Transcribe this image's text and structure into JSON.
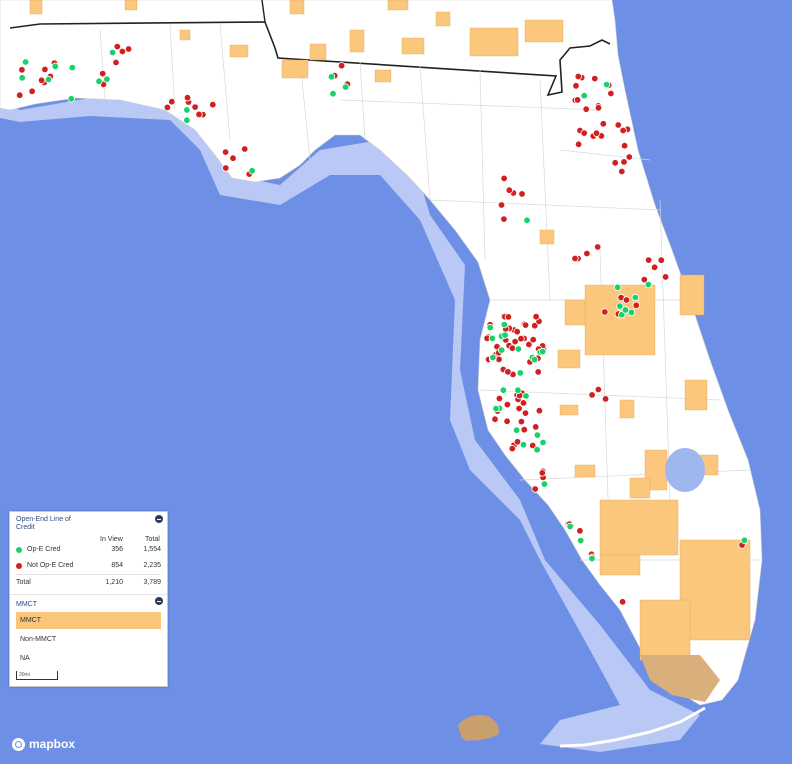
{
  "map": {
    "colors": {
      "water": "#6d8fe6",
      "shelf": "#b9c8f4",
      "land": "#ffffff",
      "mmct": "#fbc77d",
      "na": "#d9b07c",
      "op_e_cred": "#19d16a",
      "not_op_e_cred": "#d0201f"
    }
  },
  "legend": {
    "title": "Open-End Line of Credit",
    "col_in_view": "In View",
    "col_total": "Total",
    "rows": [
      {
        "label": "Op-E Cred",
        "in_view": "356",
        "total": "1,554",
        "color": "#19d16a"
      },
      {
        "label": "Not Op-E Cred",
        "in_view": "854",
        "total": "2,235",
        "color": "#d0201f"
      }
    ],
    "total": {
      "label": "Total",
      "in_view": "1,210",
      "total": "3,789"
    }
  },
  "layer_legend": {
    "title": "MMCT",
    "items": [
      "MMCT",
      "Non-MMCT",
      "NA"
    ],
    "scale": "30mi"
  },
  "brand": {
    "logo": "mapbox"
  }
}
